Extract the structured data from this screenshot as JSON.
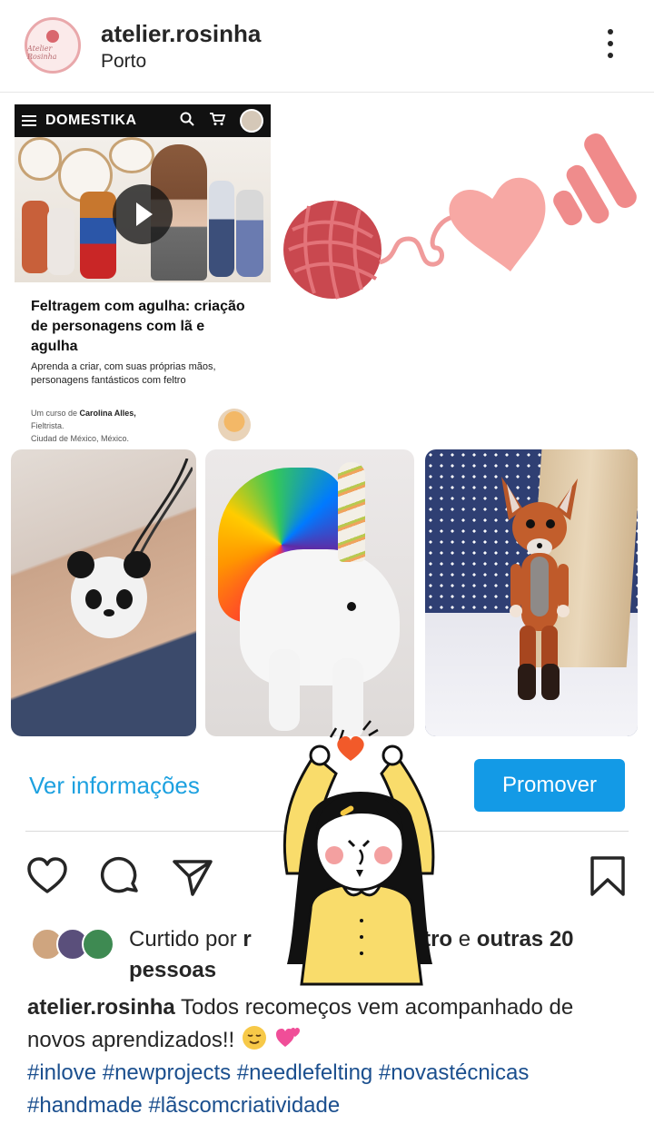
{
  "header": {
    "username": "atelier.rosinha",
    "location": "Porto",
    "avatar_text": "Atelier Rosinha"
  },
  "card": {
    "brand": "DOMESTIKA",
    "title": "Feltragem com agulha: criação de personagens com lã e agulha",
    "subtitle": "Aprenda a criar, com suas próprias mãos, personagens fantásticos com feltro",
    "by_prefix": "Um curso de",
    "author": "Carolina Alles,",
    "author_role": "Fieltrista.",
    "author_place": "Ciudad de México, México."
  },
  "actions": {
    "info_label": "Ver informações",
    "promote_label": "Promover"
  },
  "likes": {
    "prefix": "Curtido por",
    "visible_name_start": "r",
    "visible_name_end": "stro",
    "joiner": "e",
    "others": "outras 20 pessoas"
  },
  "caption": {
    "username": "atelier.rosinha",
    "text": "Todos recomeços vem acompanhado de novos aprendizados!!",
    "hashtags": "#inlove #newprojects #needlefelting #novastécnicas #handmade #lãscomcriatividade"
  },
  "colors": {
    "accent": "#139ae6",
    "link_blue": "#1da1e0",
    "hashtag": "#1b4f8e",
    "sticker_yellow": "#f9dc6b",
    "heart_pink": "#f7a8a4"
  },
  "icons": {
    "more": "more-vertical-icon",
    "like": "heart-icon",
    "comment": "comment-icon",
    "share": "send-icon",
    "save": "bookmark-icon"
  }
}
